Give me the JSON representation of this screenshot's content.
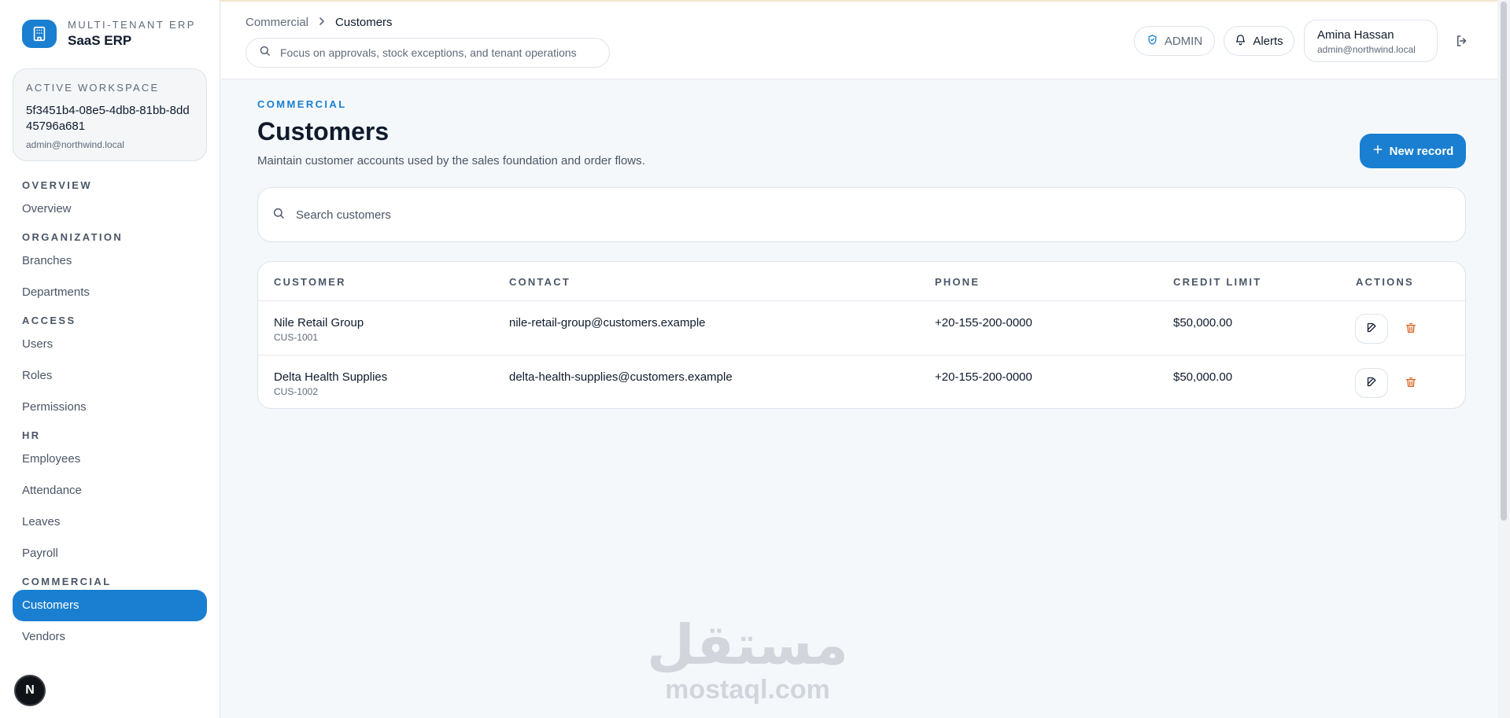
{
  "brand": {
    "kicker": "MULTI-TENANT ERP",
    "name": "SaaS ERP",
    "icon": "building-icon"
  },
  "workspace": {
    "kicker": "ACTIVE WORKSPACE",
    "id": "5f3451b4-08e5-4db8-81bb-8dd45796a681",
    "email": "admin@northwind.local"
  },
  "sidebar": {
    "sections": [
      {
        "title": "OVERVIEW",
        "items": [
          {
            "label": "Overview",
            "active": false
          }
        ]
      },
      {
        "title": "ORGANIZATION",
        "items": [
          {
            "label": "Branches",
            "active": false
          },
          {
            "label": "Departments",
            "active": false
          }
        ]
      },
      {
        "title": "ACCESS",
        "items": [
          {
            "label": "Users",
            "active": false
          },
          {
            "label": "Roles",
            "active": false
          },
          {
            "label": "Permissions",
            "active": false
          }
        ]
      },
      {
        "title": "HR",
        "items": [
          {
            "label": "Employees",
            "active": false
          },
          {
            "label": "Attendance",
            "active": false
          },
          {
            "label": "Leaves",
            "active": false
          },
          {
            "label": "Payroll",
            "active": false
          }
        ]
      },
      {
        "title": "COMMERCIAL",
        "items": [
          {
            "label": "Customers",
            "active": true
          },
          {
            "label": "Vendors",
            "active": false
          }
        ]
      }
    ]
  },
  "badge": {
    "letter": "N"
  },
  "header": {
    "breadcrumb": {
      "parent": "Commercial",
      "current": "Customers"
    },
    "focus_placeholder": "Focus on approvals, stock exceptions, and tenant operations",
    "role_label": "ADMIN",
    "alerts_label": "Alerts",
    "user": {
      "name": "Amina Hassan",
      "email": "admin@northwind.local"
    }
  },
  "page": {
    "kicker": "COMMERCIAL",
    "title": "Customers",
    "subtitle": "Maintain customer accounts used by the sales foundation and order flows.",
    "new_button": "New record",
    "search_placeholder": "Search customers"
  },
  "table": {
    "columns": [
      "CUSTOMER",
      "CONTACT",
      "PHONE",
      "CREDIT LIMIT",
      "ACTIONS"
    ],
    "rows": [
      {
        "name": "Nile Retail Group",
        "code": "CUS-1001",
        "contact": "nile-retail-group@customers.example",
        "phone": "+20-155-200-0000",
        "credit": "$50,000.00"
      },
      {
        "name": "Delta Health Supplies",
        "code": "CUS-1002",
        "contact": "delta-health-supplies@customers.example",
        "phone": "+20-155-200-0000",
        "credit": "$50,000.00"
      }
    ]
  },
  "watermark": {
    "arabic": "مستقل",
    "latin": "mostaql.com"
  },
  "colors": {
    "accent": "#1a7fd0",
    "danger": "#d9631e",
    "text": "#0f1b2d",
    "muted": "#5f6b7a"
  }
}
